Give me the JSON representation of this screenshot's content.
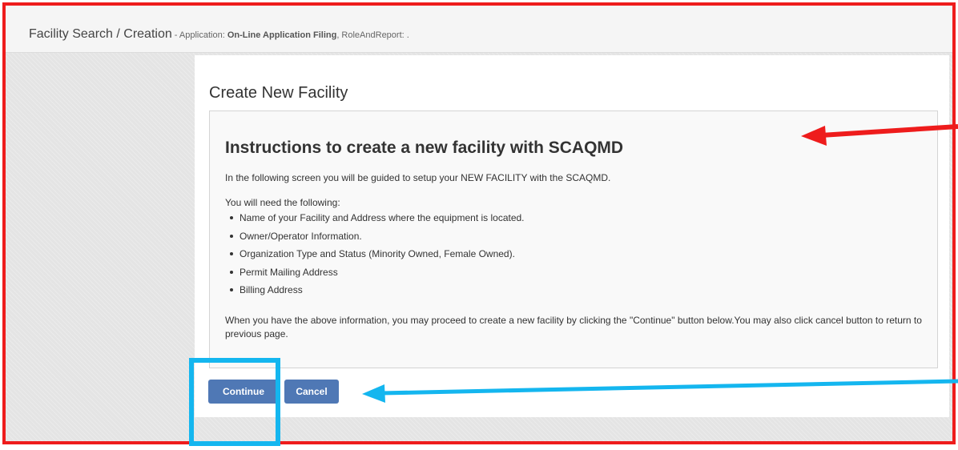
{
  "header": {
    "title": "Facility Search / Creation",
    "separator": " - ",
    "app_label": "Application: ",
    "app_name": "On-Line Application Filing",
    "role_suffix": ", RoleAndReport: ."
  },
  "panel": {
    "title": "Create New Facility",
    "heading": "Instructions to create a new facility with SCAQMD",
    "intro": "In the following screen you will be guided to setup your NEW FACILITY with the SCAQMD.",
    "need_label": "You will need the following:",
    "items": [
      "Name of your Facility and Address where the equipment is located.",
      "Owner/Operator Information.",
      "Organization Type and Status (Minority Owned, Female Owned).",
      "Permit Mailing Address",
      "Billing Address"
    ],
    "closing": "When you have the above information, you may proceed to create a new facility by clicking the \"Continue\" button below.You may also click cancel button to return to previous page."
  },
  "buttons": {
    "continue": "Continue",
    "cancel": "Cancel"
  },
  "annotations": {
    "frame_color": "#ee1c1c",
    "red_arrow_color": "#ee1c1c",
    "blue_arrow_color": "#14b6ef",
    "callout_color": "#14b6ef"
  }
}
